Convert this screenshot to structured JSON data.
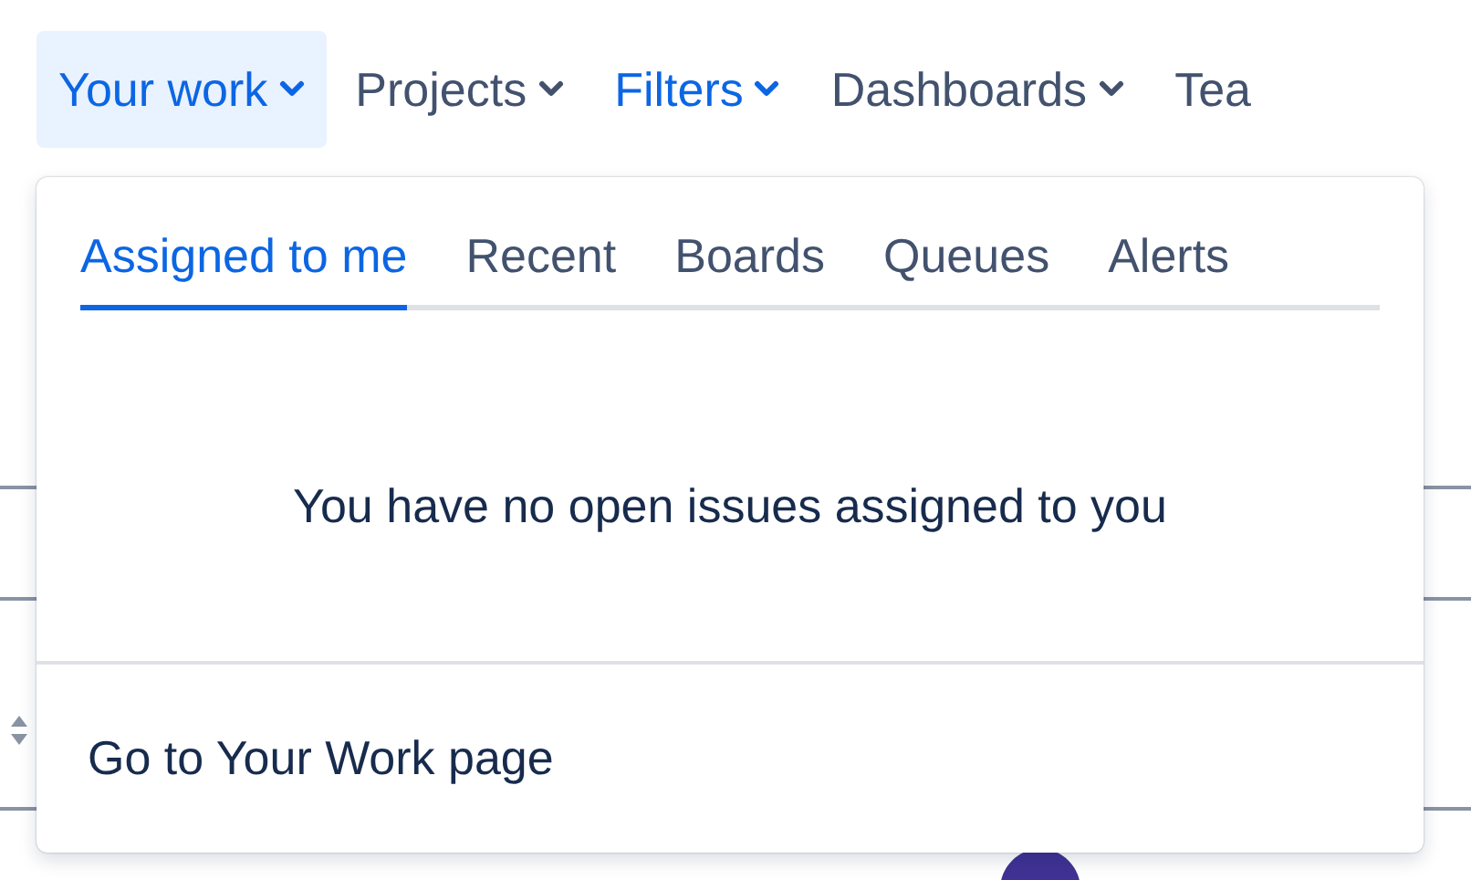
{
  "nav": [
    {
      "label": "Your work",
      "selected": true,
      "caret": true
    },
    {
      "label": "Projects",
      "selected": false,
      "caret": true
    },
    {
      "label": "Filters",
      "selected": false,
      "highlighted": true,
      "caret": true
    },
    {
      "label": "Dashboards",
      "selected": false,
      "caret": true
    },
    {
      "label": "Tea",
      "selected": false,
      "caret": false
    }
  ],
  "dropdown": {
    "tabs": [
      {
        "label": "Assigned to me",
        "selected": true
      },
      {
        "label": "Recent",
        "selected": false
      },
      {
        "label": "Boards",
        "selected": false
      },
      {
        "label": "Queues",
        "selected": false
      },
      {
        "label": "Alerts",
        "selected": false
      }
    ],
    "message": "You have no open issues assigned to you",
    "footer_link": "Go to Your Work page"
  }
}
